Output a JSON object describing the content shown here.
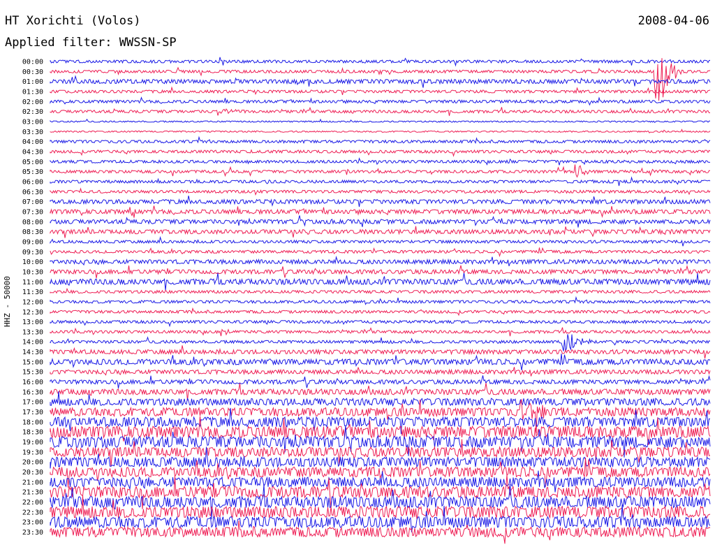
{
  "header": {
    "station": "HT Xorichti (Volos)",
    "date": "2008-04-06",
    "filter": "Applied filter: WWSSN-SP",
    "channel": "HHZ - 50000"
  },
  "colors": {
    "blue": "#1a1ae6",
    "red": "#ee1f55"
  },
  "chart_data": {
    "type": "line",
    "title": "",
    "rows": [
      "00:00",
      "00:30",
      "01:00",
      "01:30",
      "02:00",
      "02:30",
      "03:00",
      "03:30",
      "04:00",
      "04:30",
      "05:00",
      "05:30",
      "06:00",
      "06:30",
      "07:00",
      "07:30",
      "08:00",
      "08:30",
      "09:00",
      "09:30",
      "10:00",
      "10:30",
      "11:00",
      "11:30",
      "12:00",
      "12:30",
      "13:00",
      "13:30",
      "14:00",
      "14:30",
      "15:00",
      "15:30",
      "16:00",
      "16:30",
      "17:00",
      "17:30",
      "18:00",
      "18:30",
      "19:00",
      "19:30",
      "20:00",
      "20:30",
      "21:00",
      "21:30",
      "22:00",
      "22:30",
      "23:00",
      "23:30"
    ],
    "noise_level": [
      2,
      2,
      3,
      2,
      2,
      2,
      1,
      1,
      2,
      2,
      2,
      2,
      2,
      2,
      3,
      3,
      3,
      3,
      2,
      2,
      3,
      3,
      4,
      2,
      2,
      2,
      2,
      2,
      2,
      3,
      4,
      3,
      3,
      4,
      5,
      6,
      7,
      8,
      8,
      7,
      7,
      7,
      7,
      8,
      8,
      8,
      8,
      7
    ],
    "events": [
      {
        "row": 1,
        "minute": 27.5,
        "amplitude": 90,
        "length": 1.2
      },
      {
        "row": 5,
        "minute": 7.6,
        "amplitude": 4,
        "length": 2.0
      },
      {
        "row": 11,
        "minute": 23.9,
        "amplitude": 14,
        "length": 0.8
      },
      {
        "row": 15,
        "minute": 3.6,
        "amplitude": 6,
        "length": 0.5
      },
      {
        "row": 27,
        "minute": 7.8,
        "amplitude": 9,
        "length": 0.6
      },
      {
        "row": 28,
        "minute": 23.3,
        "amplitude": 20,
        "length": 1.5
      },
      {
        "row": 35,
        "minute": 21.4,
        "amplitude": 26,
        "length": 0.9
      },
      {
        "row": 35,
        "minute": 22.1,
        "amplitude": 24,
        "length": 0.9
      }
    ]
  }
}
